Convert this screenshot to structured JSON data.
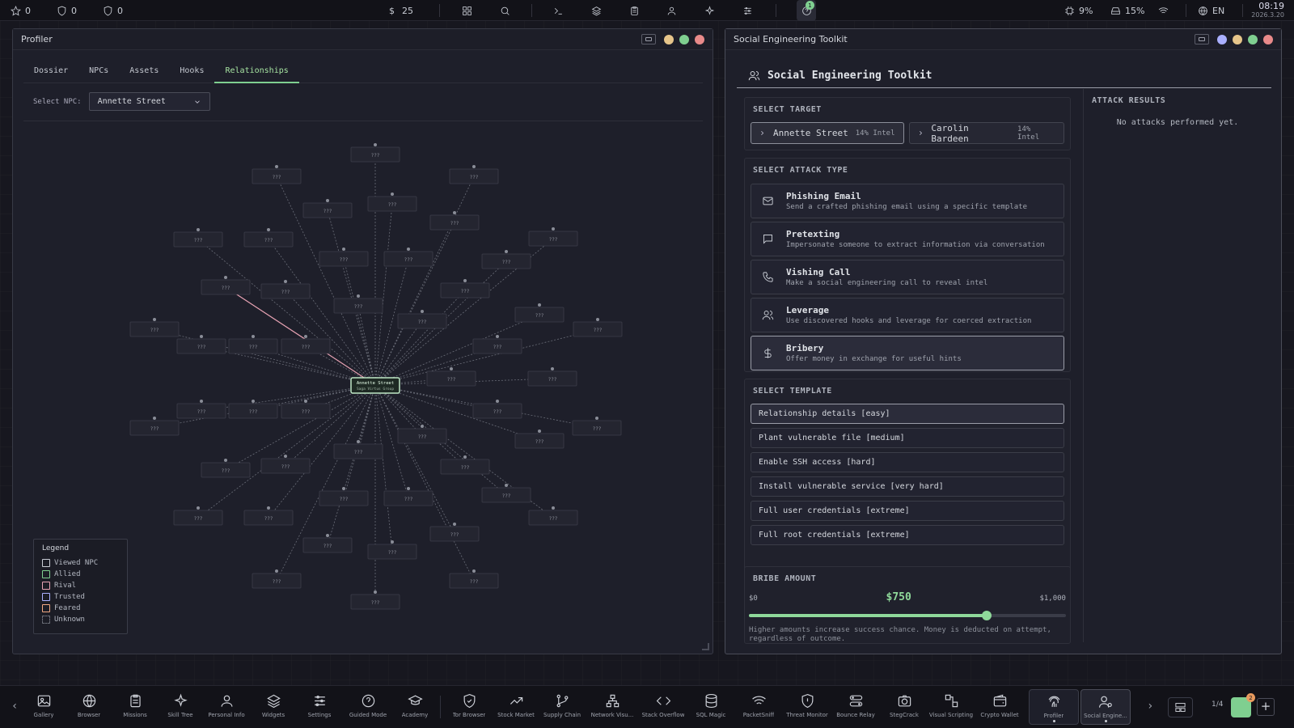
{
  "topbar": {
    "stars": "0",
    "shield_a": "0",
    "shield_b": "0",
    "currency_symbol": "$",
    "money": "25",
    "notifications": "1",
    "cpu": "9%",
    "disk": "15%",
    "language": "EN",
    "time": "08:19",
    "date": "2026.3.20"
  },
  "profiler": {
    "title": "Profiler",
    "tabs": [
      "Dossier",
      "NPCs",
      "Assets",
      "Hooks",
      "Relationships"
    ],
    "active_tab": "Relationships",
    "select_label": "Select NPC:",
    "selected_npc": "Annette Street",
    "graph": {
      "center_name": "Annette Street",
      "center_org": "Saga Virtus Group",
      "unknown_label": "???",
      "highlight_color": "#e8a3b4"
    },
    "legend": {
      "title": "Legend",
      "items": [
        {
          "label": "Viewed NPC",
          "color": "#c8ccd4"
        },
        {
          "label": "Allied",
          "color": "#7fcf90"
        },
        {
          "label": "Rival",
          "color": "#e8a3b4"
        },
        {
          "label": "Trusted",
          "color": "#aab0ff"
        },
        {
          "label": "Feared",
          "color": "#f2a983"
        },
        {
          "label": "Unknown",
          "color": "#6d707a"
        }
      ]
    }
  },
  "toolkit": {
    "window_title": "Social Engineering Toolkit",
    "header": "Social Engineering Toolkit",
    "select_target_title": "SELECT TARGET",
    "targets": [
      {
        "name": "Annette Street",
        "intel": "14% Intel",
        "selected": true
      },
      {
        "name": "Carolin Bardeen",
        "intel": "14% Intel",
        "selected": false
      }
    ],
    "attack_type_title": "SELECT ATTACK TYPE",
    "attacks": [
      {
        "name": "Phishing Email",
        "desc": "Send a crafted phishing email using a specific template",
        "icon": "mail-icon"
      },
      {
        "name": "Pretexting",
        "desc": "Impersonate someone to extract information via conversation",
        "icon": "chat-icon"
      },
      {
        "name": "Vishing Call",
        "desc": "Make a social engineering call to reveal intel",
        "icon": "phone-icon"
      },
      {
        "name": "Leverage",
        "desc": "Use discovered hooks and leverage for coerced extraction",
        "icon": "users-icon"
      },
      {
        "name": "Bribery",
        "desc": "Offer money in exchange for useful hints",
        "icon": "dollar-icon",
        "selected": true
      }
    ],
    "template_title": "SELECT TEMPLATE",
    "templates": [
      {
        "label": "Relationship details [easy]",
        "selected": true
      },
      {
        "label": "Plant vulnerable file [medium]"
      },
      {
        "label": "Enable SSH access [hard]"
      },
      {
        "label": "Install vulnerable service [very hard]"
      },
      {
        "label": "Full user credentials [extreme]"
      },
      {
        "label": "Full root credentials [extreme]"
      }
    ],
    "bribe": {
      "title": "BRIBE AMOUNT",
      "min_label": "$0",
      "max_label": "$1,000",
      "value_label": "$750",
      "fraction": 0.75,
      "note": "Higher amounts increase success chance. Money is deducted on attempt, regardless of outcome."
    },
    "results": {
      "title": "ATTACK RESULTS",
      "empty": "No attacks performed yet."
    }
  },
  "dock": {
    "items": [
      {
        "label": "Gallery",
        "icon": "image-icon"
      },
      {
        "label": "Browser",
        "icon": "globe-icon"
      },
      {
        "label": "Missions",
        "icon": "clipboard-icon"
      },
      {
        "label": "Skill Tree",
        "icon": "sparkle-icon"
      },
      {
        "label": "Personal Info",
        "icon": "user-icon"
      },
      {
        "label": "Widgets",
        "icon": "layers-icon"
      },
      {
        "label": "Settings",
        "icon": "sliders-icon"
      },
      {
        "label": "Guided Mode",
        "icon": "help-icon"
      },
      {
        "label": "Academy",
        "icon": "graduation-icon"
      },
      {
        "label": "Tor Browser",
        "icon": "shield-icon"
      },
      {
        "label": "Stock Market",
        "icon": "trend-icon"
      },
      {
        "label": "Supply Chain",
        "icon": "branch-icon"
      },
      {
        "label": "Network Visu...",
        "icon": "network-icon"
      },
      {
        "label": "Stack Overflow",
        "icon": "code-icon"
      },
      {
        "label": "SQL Magic",
        "icon": "database-icon"
      },
      {
        "label": "PacketSniff",
        "icon": "wifi-icon"
      },
      {
        "label": "Threat Monitor",
        "icon": "shield-alert-icon"
      },
      {
        "label": "Bounce Relay",
        "icon": "relay-icon"
      },
      {
        "label": "StegCrack",
        "icon": "camera-icon"
      },
      {
        "label": "Visual Scripting",
        "icon": "nodes-icon"
      },
      {
        "label": "Crypto Wallet",
        "icon": "wallet-icon"
      },
      {
        "label": "Profiler",
        "icon": "fingerprint-icon",
        "open": true
      },
      {
        "label": "Social Engine...",
        "icon": "user-gear-icon",
        "active": true
      }
    ],
    "page": "1/4",
    "badge": "2"
  }
}
